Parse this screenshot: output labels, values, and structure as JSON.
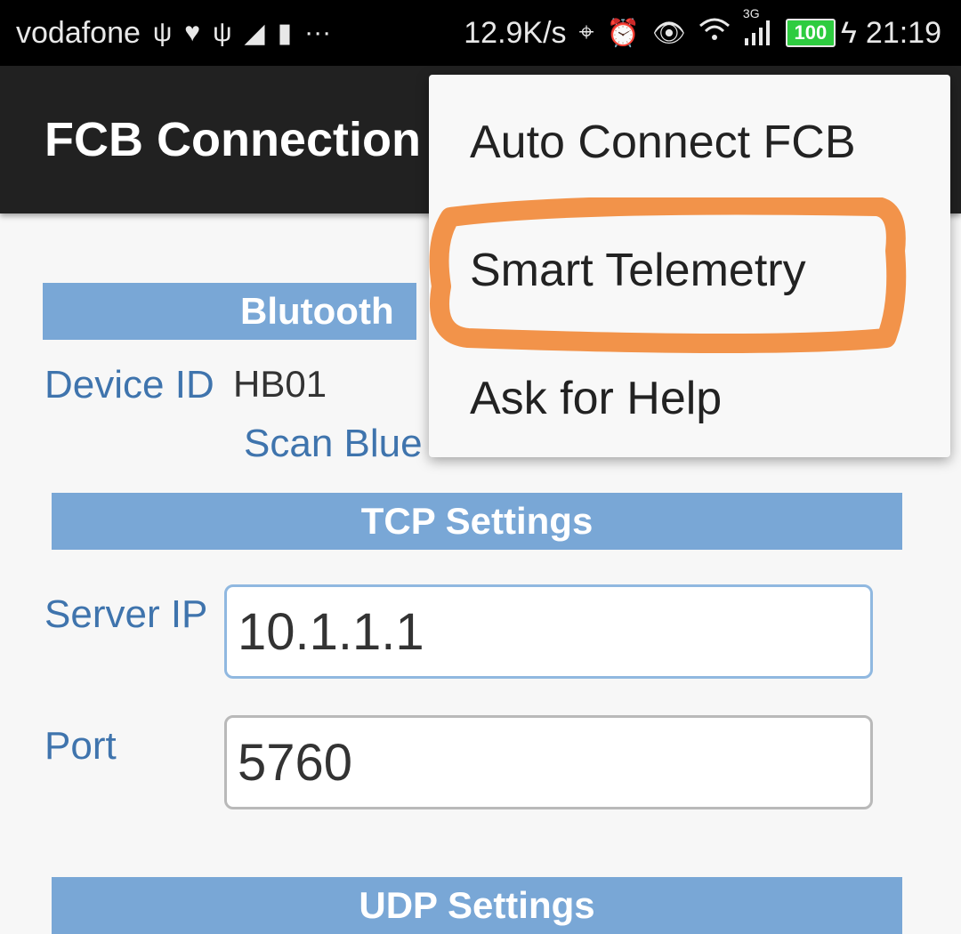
{
  "status_bar": {
    "carrier": "vodafone",
    "more": "···",
    "speed": "12.9K/s",
    "network": "3G",
    "battery": "100",
    "time": "21:19",
    "icons": [
      "usb-icon",
      "health-icon",
      "usb-icon",
      "signal-triangle-icon",
      "sim-alert-icon",
      "location-icon",
      "alarm-icon",
      "eye-icon",
      "wifi-icon",
      "cell-signal-icon",
      "battery-icon",
      "charging-icon"
    ]
  },
  "app_bar": {
    "title": "FCB Connection"
  },
  "bluetooth": {
    "header": "Blutooth",
    "device_id_label": "Device ID",
    "device_id_value": "HB01",
    "scan_button": "Scan Blue"
  },
  "tcp": {
    "header": "TCP Settings",
    "server_ip_label": "Server IP",
    "server_ip_value": "10.1.1.1",
    "port_label": "Port",
    "port_value": "5760"
  },
  "udp": {
    "header": "UDP Settings"
  },
  "menu": {
    "items": [
      "Auto Connect FCB",
      "Smart Telemetry",
      "Ask for Help"
    ]
  },
  "colors": {
    "section_bar": "#79a7d6",
    "label_blue": "#3f74ad",
    "highlight_stroke": "#f2934a",
    "app_bar": "#212121"
  }
}
